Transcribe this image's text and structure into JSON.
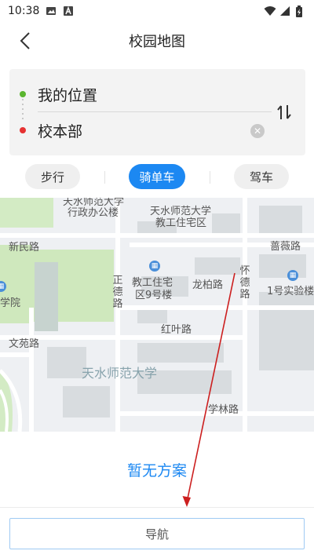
{
  "status_bar": {
    "time": "10:38",
    "icons_left": [
      "image-icon",
      "a-icon"
    ],
    "icons_right": [
      "wifi-icon",
      "signal-icon",
      "battery-icon"
    ]
  },
  "header": {
    "title": "校园地图",
    "back_icon": "chevron-left-icon"
  },
  "route": {
    "from": "我的位置",
    "to": "校本部",
    "from_dot_color": "#5ab52f",
    "to_dot_color": "#e63232",
    "clear_icon": "close-circle-icon",
    "swap_icon": "swap-vertical-icon"
  },
  "modes": {
    "items": [
      {
        "label": "步行",
        "active": false
      },
      {
        "label": "骑单车",
        "active": true
      },
      {
        "label": "驾车",
        "active": false
      }
    ],
    "active_color": "#1c88f2"
  },
  "map": {
    "labels": {
      "l1": "天水师范大学",
      "l2": "行政办公楼",
      "l3": "天水师范大学",
      "l4": "教工住宅区",
      "l5": "新民路",
      "l6": "蔷薇路",
      "l7": "教工住宅",
      "l8": "区9号楼",
      "l9": "正德路",
      "l10": "龙柏路",
      "l11": "怀德路",
      "l12": "1号实验楼",
      "l13": "学院",
      "l14": "红叶路",
      "l15": "文苑路",
      "l16": "天水师范大学",
      "l17": "学林路"
    }
  },
  "result": {
    "no_plan": "暂无方案"
  },
  "bottom": {
    "nav_label": "导航"
  },
  "annotation": {
    "arrow_color": "#cc1f1f"
  }
}
